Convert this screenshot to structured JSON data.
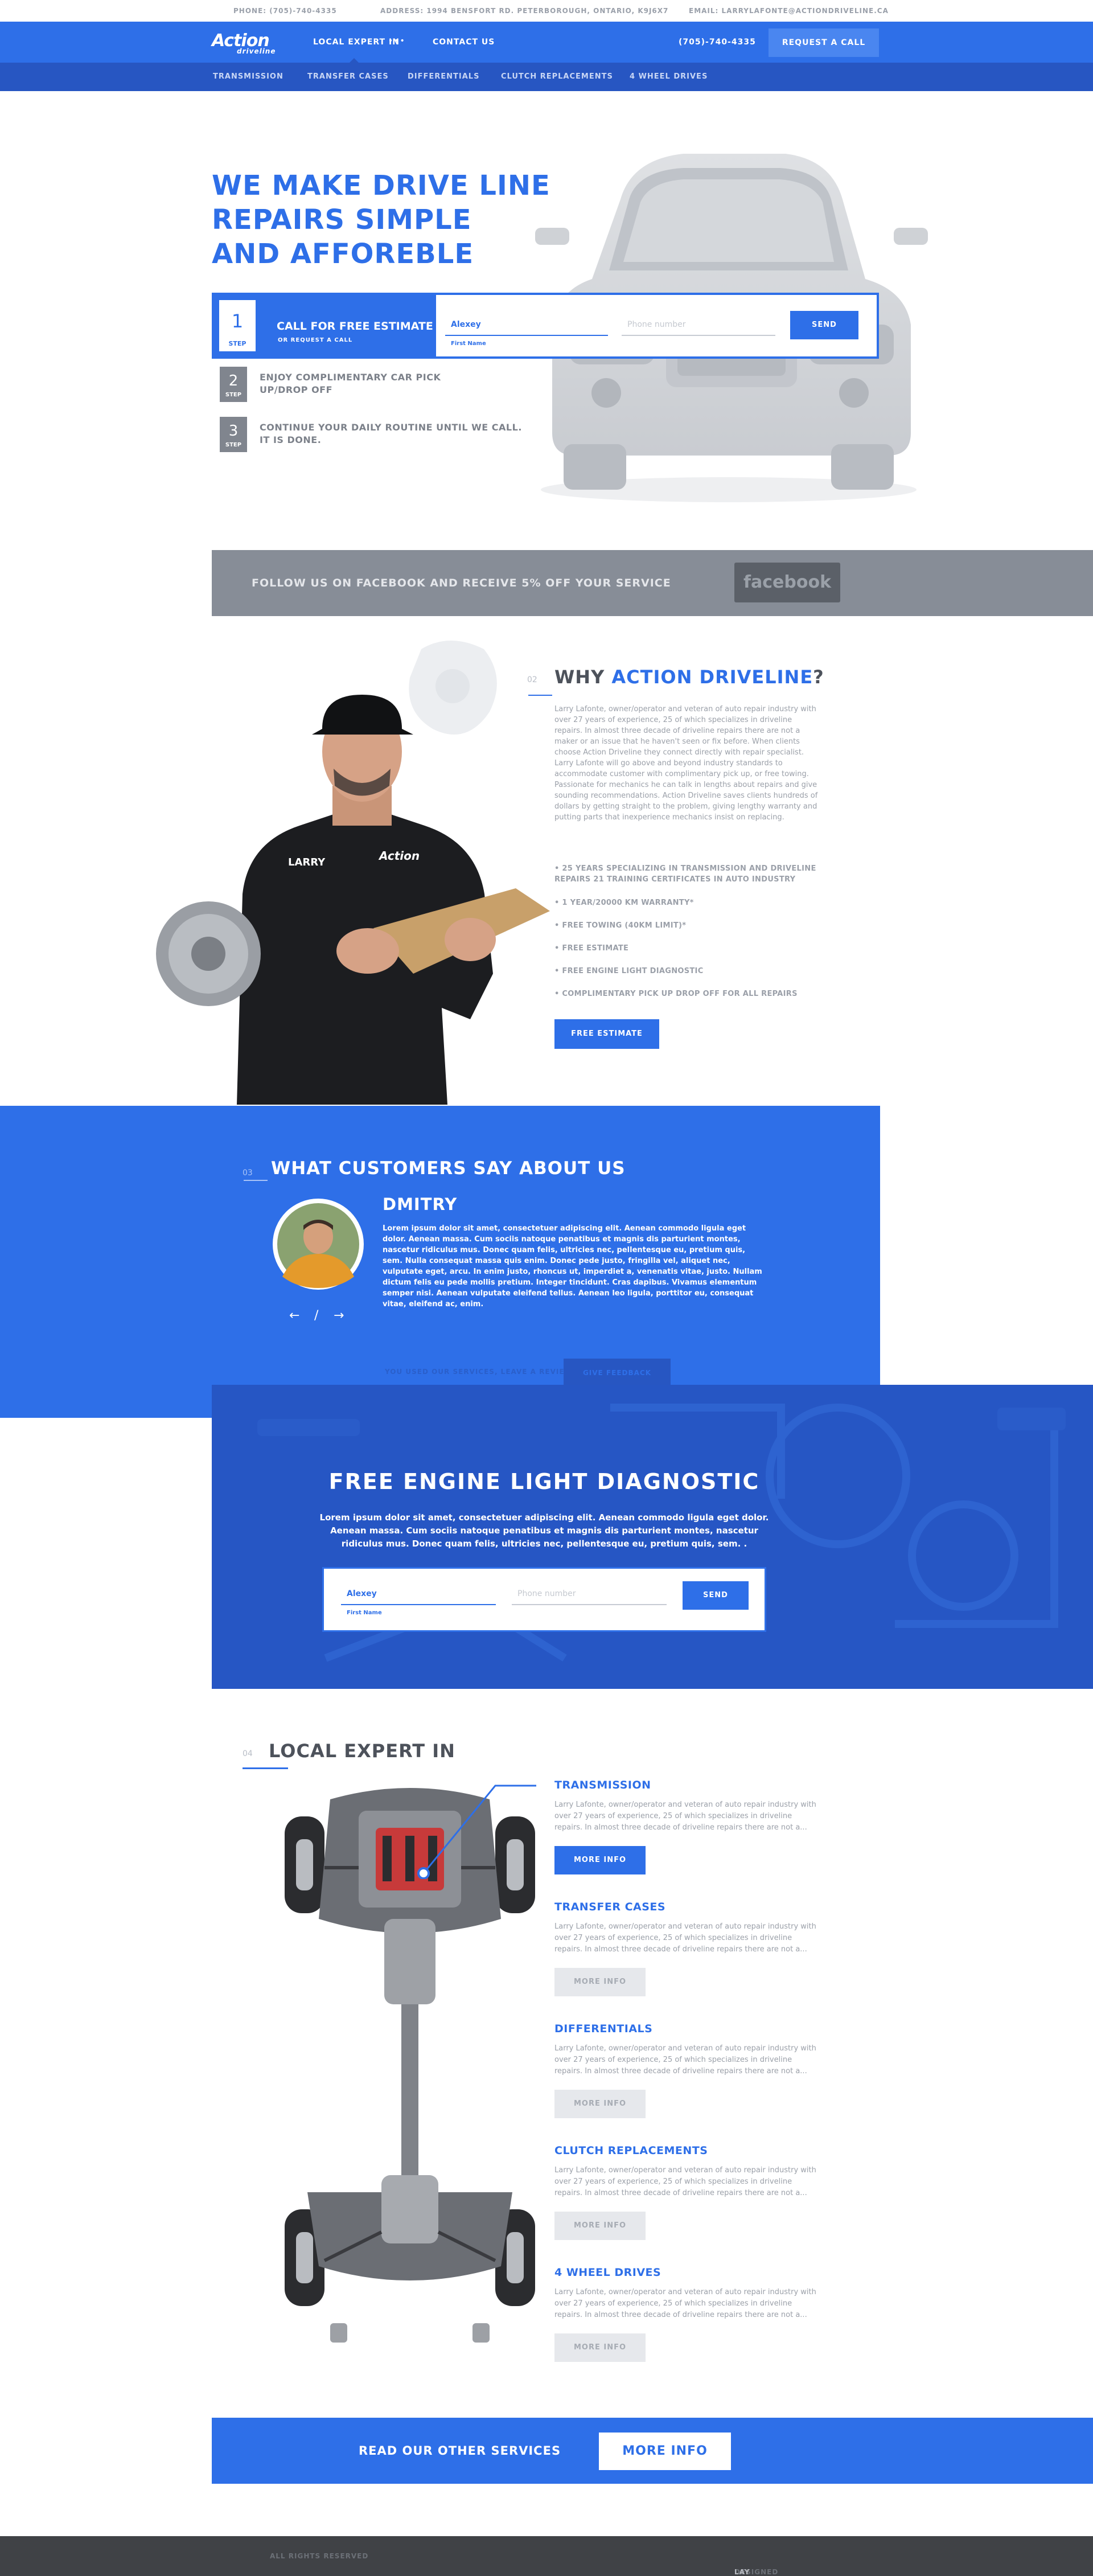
{
  "topbar": {
    "phone": "PHONE: (705)-740-4335",
    "address": "ADDRESS: 1994 BENSFORT RD. PETERBOROUGH, ONTARIO, K9J6X7",
    "email": "EMAIL: LARRYLAFONTE@ACTIONDRIVELINE.CA"
  },
  "nav": {
    "logo_main": "Action",
    "logo_sub": "driveline",
    "local_expert": "LOCAL EXPERT IN",
    "dots": "•••",
    "contact": "CONTACT US",
    "phone": "(705)-740-4335",
    "request_call": "REQUEST A CALL"
  },
  "subnav": [
    "TRANSMISSION",
    "TRANSFER CASES",
    "DIFFERENTIALS",
    "CLUTCH REPLACEMENTS",
    "4 WHEEL DRIVES"
  ],
  "hero": {
    "title_line1": "WE MAKE DRIVE LINE",
    "title_line2": "REPAIRS SIMPLE",
    "title_line3": "AND AFFOREBLE",
    "step1_num": "1",
    "step_label": "STEP",
    "estimate_title": "CALL FOR FREE ESTIMATE",
    "estimate_sub": "OR REQUEST A CALL",
    "name_value": "Alexey",
    "name_label": "First Name",
    "phone_placeholder": "Phone number",
    "send": "SEND",
    "step2_num": "2",
    "step2_text_1": "ENJOY COMPLIMENTARY CAR PICK",
    "step2_text_2": "UP/DROP OFF",
    "step3_num": "3",
    "step3_text_1": "CONTINUE YOUR DAILY ROUTINE UNTIL WE CALL.",
    "step3_text_2": "IT IS DONE."
  },
  "facebook": {
    "text": "FOLLOW US ON FACEBOOK AND RECEIVE 5% OFF YOUR SERVICE",
    "button": "facebook"
  },
  "why": {
    "num": "02",
    "title_pre": "WHY ",
    "title_hl": "ACTION DRIVELINE",
    "title_post": "?",
    "body": "Larry Lafonte, owner/operator and veteran of auto repair industry with over 27 years of experience, 25 of which specializes in driveline repairs. In almost three decade of driveline repairs there are not a maker or an issue that he haven't seen or fix before. When clients choose Action Driveline they connect directly with repair specialist. Larry Lafonte will go above and beyond industry standards to accommodate customer with complimentary pick up, or free towing. Passionate for mechanics he can talk in lengths about repairs and give sounding recommendations. Action Driveline saves clients hundreds of dollars by getting straight to the problem, giving lengthy warranty and putting parts that inexperience mechanics insist on replacing.",
    "bullets": [
      "• 25 YEARS SPECIALIZING IN TRANSMISSION AND DRIVELINE REPAIRS 21 TRAINING CERTIFICATES IN AUTO INDUSTRY",
      "• 1 YEAR/20000 KM WARRANTY*",
      "• FREE TOWING (40KM LIMIT)*",
      "• FREE ESTIMATE",
      "• FREE ENGINE LIGHT DIAGNOSTIC",
      "• COMPLIMENTARY PICK UP DROP OFF FOR ALL REPAIRS"
    ],
    "button": "FREE ESTIMATE",
    "shirt_name": "LARRY"
  },
  "testimonials": {
    "num": "03",
    "title": "WHAT CUSTOMERS SAY ABOUT US",
    "name": "DMITRY",
    "body": "Lorem ipsum dolor sit amet, consectetuer adipiscing elit. Aenean commodo ligula eget dolor. Aenean massa. Cum sociis natoque penatibus et magnis dis parturient montes, nascetur ridiculus mus. Donec quam felis, ultricies nec, pellentesque eu, pretium quis, sem. Nulla consequat massa quis enim. Donec pede justo, fringilla vel, aliquet nec, vulputate eget, arcu. In enim justo, rhoncus ut, imperdiet a, venenatis vitae, justo. Nullam dictum felis eu pede mollis pretium. Integer tincidunt. Cras dapibus. Vivamus elementum semper nisi. Aenean vulputate eleifend tellus. Aenean leo ligula, porttitor eu, consequat vitae, eleifend ac, enim.",
    "prev": "←",
    "sep": "/",
    "next": "→",
    "cta": "YOU USED OUR SERVICES, LEAVE A REVIEW",
    "button": "GIVE FEEDBACK"
  },
  "diagnostic": {
    "title": "FREE ENGINE LIGHT DIAGNOSTIC",
    "body_1": "Lorem ipsum dolor sit amet, consectetuer adipiscing elit. Aenean commodo ligula eget dolor.",
    "body_2": "Aenean massa. Cum sociis natoque penatibus et magnis dis parturient montes, nascetur",
    "body_3": "ridiculus mus. Donec quam felis, ultricies nec, pellentesque eu, pretium quis, sem. .",
    "name_value": "Alexey",
    "name_label": "First Name",
    "phone_placeholder": "Phone number",
    "send": "SEND"
  },
  "local_expert": {
    "num": "04",
    "title": "LOCAL EXPERT IN",
    "services": [
      {
        "title": "TRANSMISSION",
        "body": "Larry Lafonte, owner/operator and veteran of auto repair industry with over 27 years of experience, 25 of which specializes in driveline repairs. In almost three decade of driveline repairs there are not a...",
        "button": "MORE INFO"
      },
      {
        "title": "TRANSFER CASES",
        "body": "Larry Lafonte, owner/operator and veteran of auto repair industry with over 27 years of experience, 25 of which specializes in driveline repairs. In almost three decade of driveline repairs there are not a...",
        "button": "MORE INFO"
      },
      {
        "title": "DIFFERENTIALS",
        "body": "Larry Lafonte, owner/operator and veteran of auto repair industry with over 27 years of experience, 25 of which specializes in driveline repairs. In almost three decade of driveline repairs there are not a...",
        "button": "MORE INFO"
      },
      {
        "title": "CLUTCH REPLACEMENTS",
        "body": "Larry Lafonte, owner/operator and veteran of auto repair industry with over 27 years of experience, 25 of which specializes in driveline repairs. In almost three decade of driveline repairs there are not a...",
        "button": "MORE INFO"
      },
      {
        "title": "4 WHEEL DRIVES",
        "body": "Larry Lafonte, owner/operator and veteran of auto repair industry with over 27 years of experience, 25 of which specializes in driveline repairs. In almost three decade of driveline repairs there are not a...",
        "button": "MORE INFO"
      }
    ]
  },
  "cta": {
    "text": "READ OUR OTHER SERVICES",
    "button": "MORE INFO"
  },
  "footer": {
    "rights": "ALL RIGHTS RESERVED",
    "designed_by": "DESIGNED BY ",
    "designer": "LAY LAY"
  },
  "colors": {
    "brand_blue": "#2e6fe8",
    "dark_blue": "#2756c2",
    "gray_band": "#878d97",
    "footer": "#404246"
  }
}
